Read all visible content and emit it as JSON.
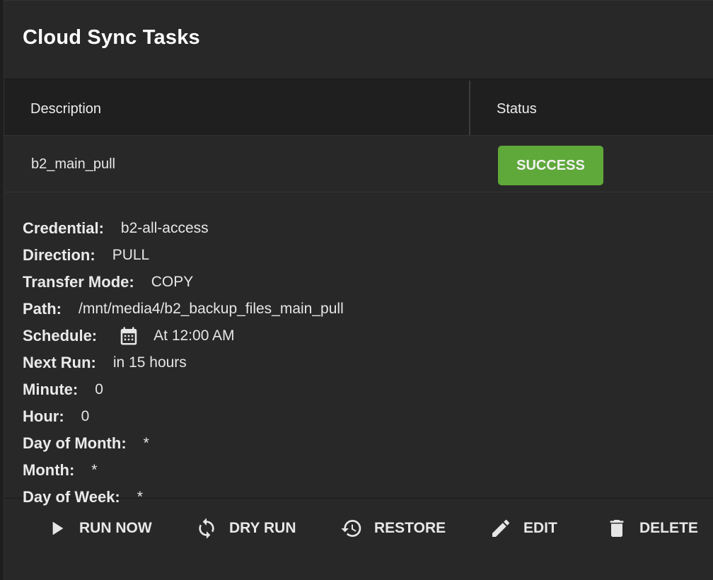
{
  "card": {
    "title": "Cloud Sync Tasks"
  },
  "table": {
    "columns": [
      "Description",
      "Status"
    ],
    "row": {
      "description": "b2_main_pull",
      "status": "SUCCESS",
      "status_color": "#5fa83a"
    }
  },
  "details": [
    {
      "label": "Credential:",
      "value": "b2-all-access"
    },
    {
      "label": "Direction:",
      "value": "PULL"
    },
    {
      "label": "Transfer Mode:",
      "value": "COPY"
    },
    {
      "label": "Path:",
      "value": "/mnt/media4/b2_backup_files_main_pull"
    },
    {
      "label": "Schedule:",
      "value": "At 12:00 AM",
      "icon": "calendar-icon"
    },
    {
      "label": "Next Run:",
      "value": "in 15 hours"
    },
    {
      "label": "Minute:",
      "value": "0"
    },
    {
      "label": "Hour:",
      "value": "0"
    },
    {
      "label": "Day of Month:",
      "value": "*"
    },
    {
      "label": "Month:",
      "value": "*"
    },
    {
      "label": "Day of Week:",
      "value": "*"
    }
  ],
  "actions": {
    "run_now": {
      "label": "RUN NOW",
      "icon": "play-icon"
    },
    "dry_run": {
      "label": "DRY RUN",
      "icon": "sync-icon"
    },
    "restore": {
      "label": "RESTORE",
      "icon": "history-icon"
    },
    "edit": {
      "label": "EDIT",
      "icon": "pencil-icon"
    },
    "delete": {
      "label": "DELETE",
      "icon": "trash-icon"
    }
  }
}
